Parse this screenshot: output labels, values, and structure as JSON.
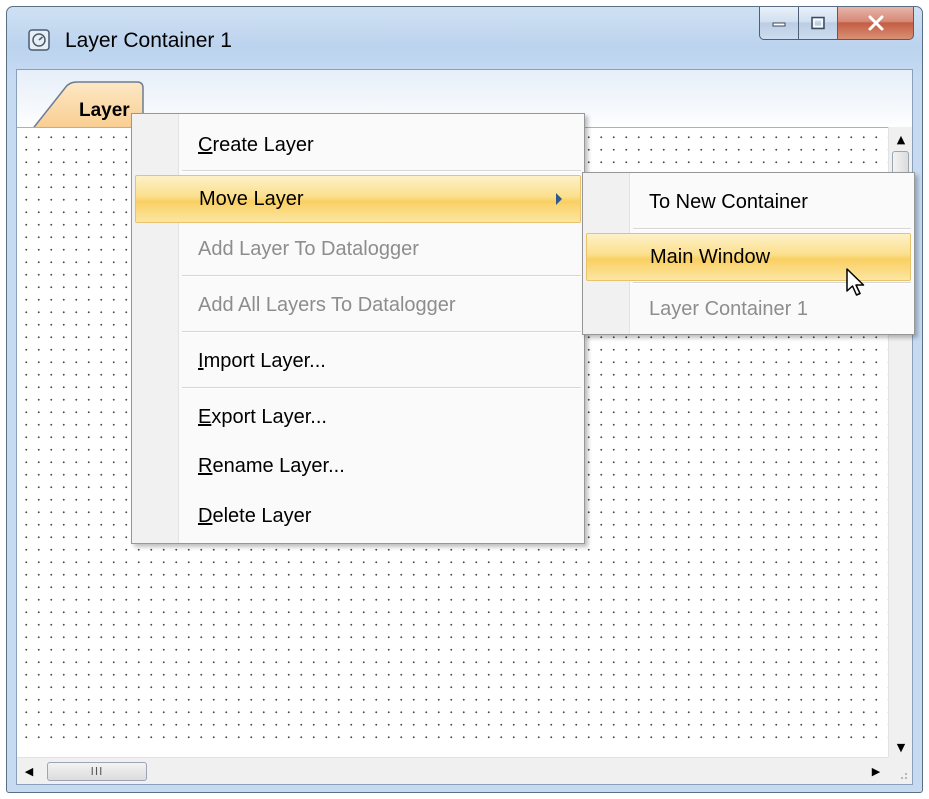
{
  "window": {
    "title": "Layer Container 1",
    "icon": "gauge-app-icon",
    "colors": {
      "menu_highlight": "#f9cf62",
      "disabled_text": "#8d8d8d",
      "close_button": "#c35e45"
    }
  },
  "tabs": [
    {
      "label": "Layer",
      "selected": true
    }
  ],
  "context_menu": {
    "items": [
      {
        "label": "Create Layer",
        "accel": "C",
        "rest": "reate Layer",
        "state": "enabled"
      },
      {
        "label": "Move Layer",
        "state": "highlighted",
        "has_submenu": true
      },
      {
        "label": "Add Layer To Datalogger",
        "state": "disabled"
      },
      {
        "label": "Add All Layers To Datalogger",
        "state": "disabled"
      },
      {
        "label": "Import Layer...",
        "accel": "I",
        "rest": "mport Layer...",
        "state": "enabled"
      },
      {
        "label": "Export Layer...",
        "accel": "E",
        "rest": "xport Layer...",
        "state": "enabled"
      },
      {
        "label": "Rename Layer...",
        "accel": "R",
        "rest": "ename Layer...",
        "state": "enabled"
      },
      {
        "label": "Delete Layer",
        "accel": "D",
        "rest": "elete Layer",
        "state": "enabled"
      }
    ]
  },
  "submenu": {
    "items": [
      {
        "label": "To New Container",
        "state": "enabled"
      },
      {
        "label": "Main Window",
        "state": "highlighted"
      },
      {
        "label": "Layer Container 1",
        "state": "disabled"
      }
    ]
  },
  "scrollbars": {
    "h_thumb_grip": "III"
  }
}
